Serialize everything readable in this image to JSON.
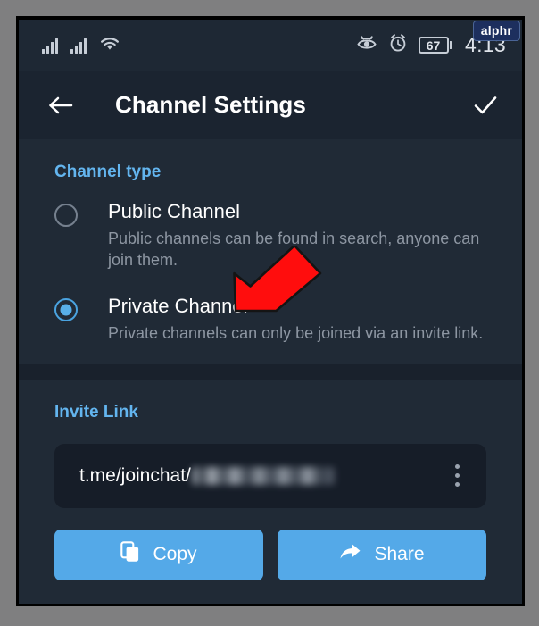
{
  "watermark": {
    "label": "alphr"
  },
  "status_bar": {
    "icons": [
      "signal-bars-icon",
      "signal-bars-icon",
      "wifi-icon",
      "eye-slash-icon",
      "alarm-clock-icon"
    ],
    "battery_level": "67",
    "time": "4:13"
  },
  "app_bar": {
    "back_icon": "back-arrow-icon",
    "title": "Channel Settings",
    "confirm_icon": "check-icon"
  },
  "channel_type": {
    "section_title": "Channel type",
    "options": [
      {
        "label": "Public Channel",
        "description": "Public channels can be found in search, anyone can join them.",
        "selected": false
      },
      {
        "label": "Private Channel",
        "description": "Private channels can only be joined via an invite link.",
        "selected": true
      }
    ]
  },
  "invite_link": {
    "section_title": "Invite Link",
    "link_prefix": "t.me/joinchat/",
    "link_token_redacted": true,
    "menu_icon": "more-vertical-icon",
    "buttons": [
      {
        "label": "Copy",
        "icon": "copy-icon"
      },
      {
        "label": "Share",
        "icon": "share-arrow-icon"
      }
    ]
  },
  "annotation": {
    "arrow_color": "#FF0D0D",
    "arrow_outline": "#111111",
    "points_to": "private-channel-option"
  },
  "colors": {
    "accent_blue": "#54a9e8",
    "section_header_blue": "#63b5ef",
    "screen_bg": "#202a36",
    "app_bar_bg": "#1b2430",
    "status_bar_bg": "#1e2834",
    "link_box_bg": "#161d28",
    "muted_text": "#8d96a2",
    "frame_gray": "#7f7f80"
  }
}
